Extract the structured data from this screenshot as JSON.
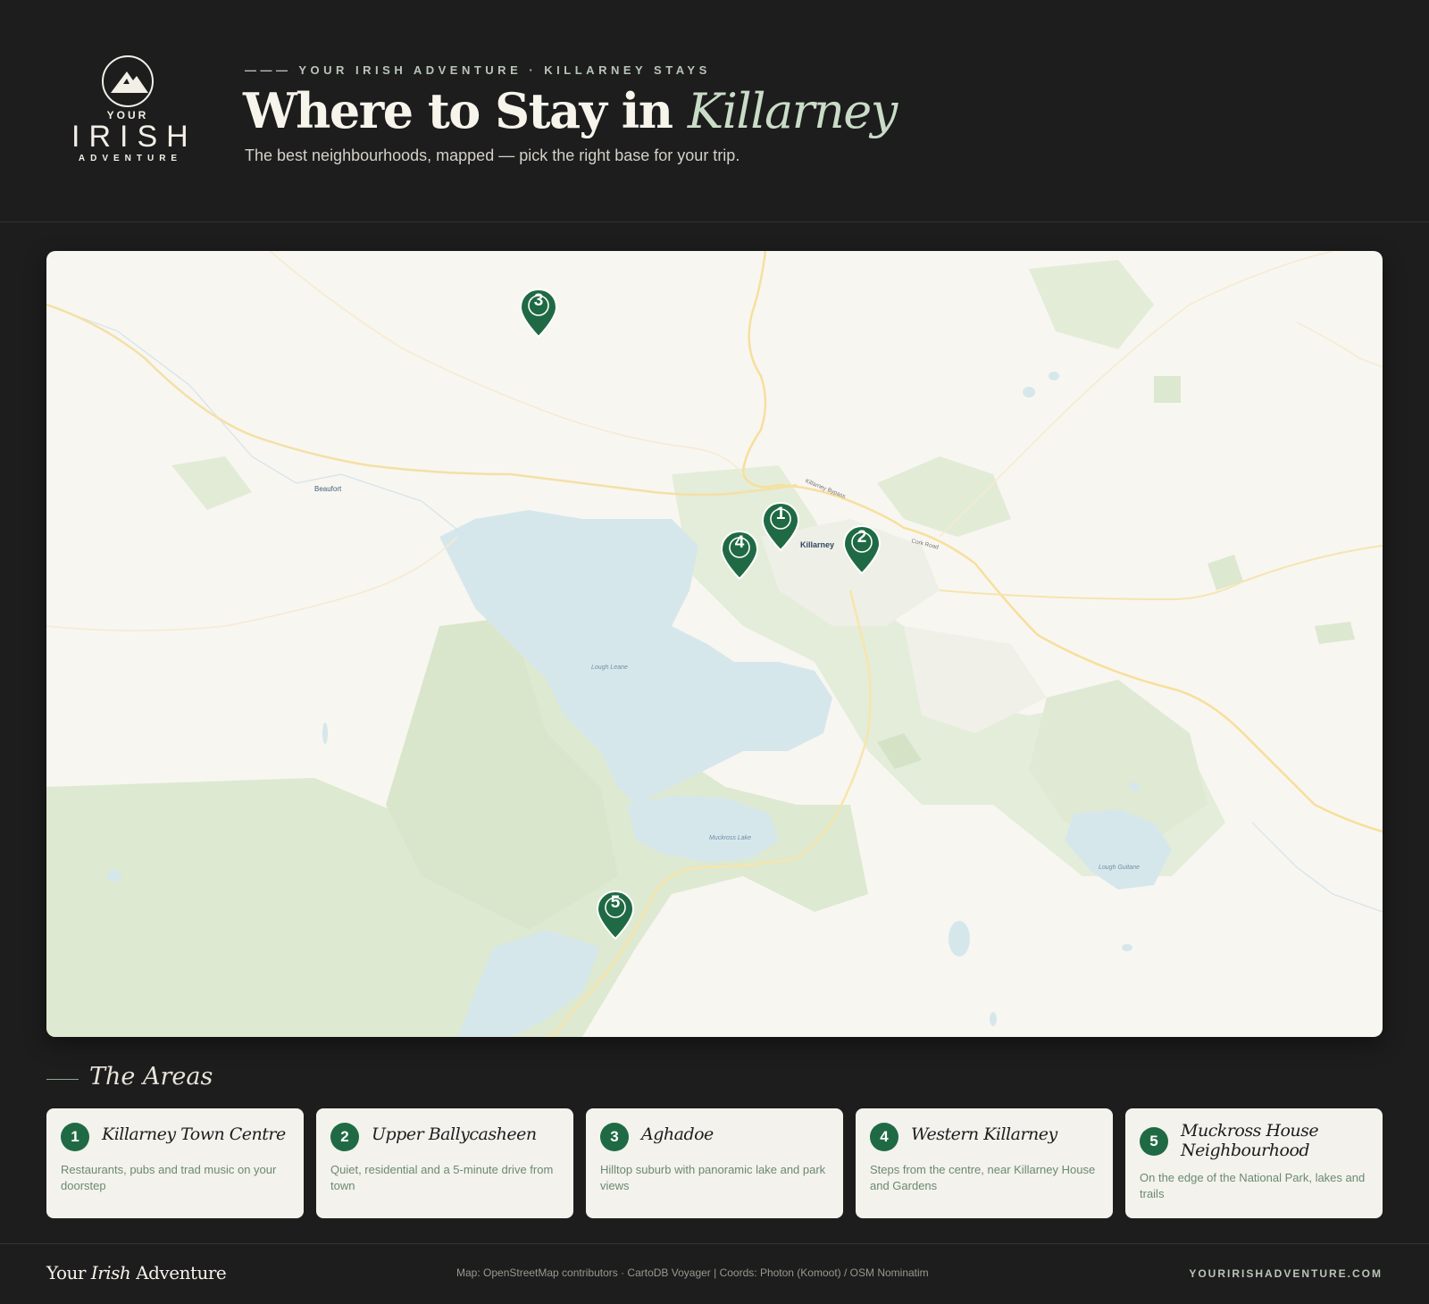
{
  "brand": {
    "logo_your": "YOUR",
    "logo_irish": "IRISH",
    "logo_adventure": "ADVENTURE"
  },
  "header": {
    "eyebrow": "——— YOUR IRISH ADVENTURE · KILLARNEY STAYS",
    "title_main": "Where to Stay in ",
    "title_emph": "Killarney",
    "subtitle": "The best neighbourhoods, mapped — pick the right base for your trip."
  },
  "map": {
    "labels": {
      "beaufort": "Beaufort",
      "killarney": "Killarney",
      "killarney_bypass": "Killarney Bypass",
      "cork_road": "Cork Road",
      "lough_leane": "Lough Leane",
      "muckross_lake": "Muckross Lake",
      "lough_guitane": "Lough Guitane"
    },
    "pins": [
      {
        "num": "1"
      },
      {
        "num": "2"
      },
      {
        "num": "3"
      },
      {
        "num": "4"
      },
      {
        "num": "5"
      }
    ],
    "colors": {
      "pin": "#1f6a44",
      "water": "#d6e7ec",
      "park": "#dde9d0",
      "road": "#f7df9c",
      "land": "#f8f6f1"
    }
  },
  "areas": {
    "title": "The Areas",
    "items": [
      {
        "num": "1",
        "name": "Killarney Town Centre",
        "desc": "Restaurants, pubs and trad music on your doorstep"
      },
      {
        "num": "2",
        "name": "Upper Ballycasheen",
        "desc": "Quiet, residential and a 5-minute drive from town"
      },
      {
        "num": "3",
        "name": "Aghadoe",
        "desc": "Hilltop suburb with panoramic lake and park views"
      },
      {
        "num": "4",
        "name": "Western Killarney",
        "desc": "Steps from the centre, near Killarney House and Gardens"
      },
      {
        "num": "5",
        "name": "Muckross House Neighbourhood",
        "desc": "On the edge of the National Park, lakes and trails"
      }
    ]
  },
  "footer": {
    "brand_1": "Your ",
    "brand_2": "Irish",
    "brand_3": " Adventure",
    "credit": "Map: OpenStreetMap contributors · CartoDB Voyager | Coords: Photon (Komoot) / OSM Nominatim",
    "url": "YOURIRISHADVENTURE.COM"
  }
}
